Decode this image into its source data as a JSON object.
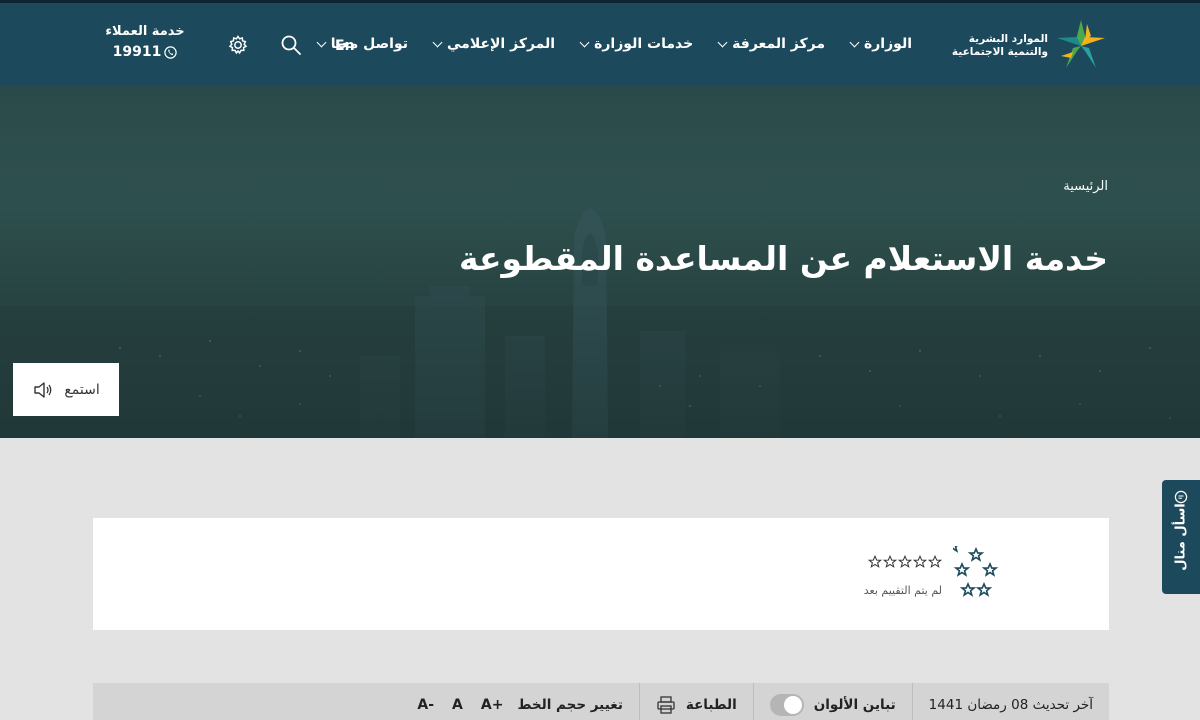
{
  "header": {
    "logo_text_line1": "الموارد البشرية",
    "logo_text_line2": "والتنمية الاجتماعية",
    "nav": [
      {
        "label": "الوزارة"
      },
      {
        "label": "مركز المعرفة"
      },
      {
        "label": "خدمات الوزارة"
      },
      {
        "label": "المركز الإعلامي"
      },
      {
        "label": "تواصل معنا"
      }
    ],
    "lang_label": "En",
    "customer_service_label": "خدمة العملاء",
    "customer_service_number": "19911"
  },
  "hero": {
    "breadcrumb": "الرئيسية",
    "title": "خدمة الاستعلام عن المساعدة المقطوعة",
    "listen_label": "استمع"
  },
  "side_tab": {
    "label": "اسأل منال"
  },
  "rating": {
    "status": "لم يتم التقييم بعد",
    "value": 0,
    "max": 5
  },
  "toolbar": {
    "last_update": "آخر تحديث 08 رمضان 1441",
    "contrast_label": "تباين الألوان",
    "print_label": "الطباعة",
    "font_size_label": "تغيير حجم الخط",
    "font_increase": "A+",
    "font_normal": "A",
    "font_decrease": "A-"
  },
  "colors": {
    "header_bg": "#1c4a5c",
    "hero_overlay": "#2f5250",
    "page_bg": "#e3e3e3",
    "logo_green": "#4aa84f",
    "logo_yellow": "#f2b21a",
    "logo_teal": "#1f8a8a"
  }
}
